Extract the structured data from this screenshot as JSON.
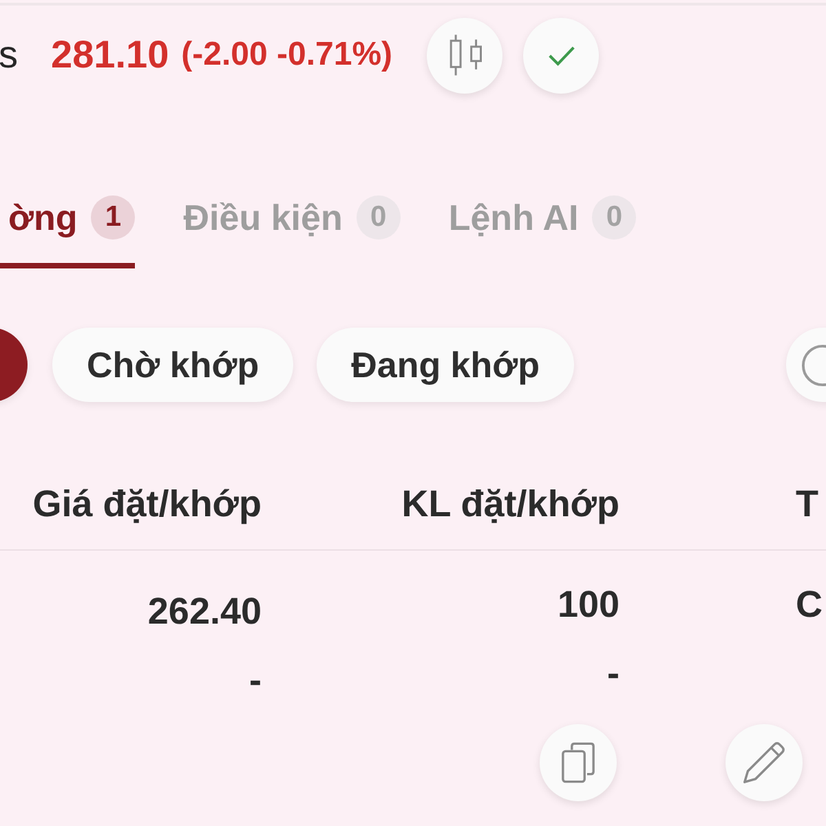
{
  "header": {
    "symbol": "s",
    "price": "281.10",
    "change": "(-2.00 -0.71%)",
    "falling": true,
    "tools": [
      {
        "kind": "candles"
      },
      {
        "kind": "confirm"
      }
    ]
  },
  "tabs": [
    {
      "label": "ờng",
      "count": "1",
      "selected": true
    },
    {
      "label": "Điều kiện",
      "count": "0",
      "selected": false
    },
    {
      "label": "Lệnh AI",
      "count": "0",
      "selected": false
    }
  ],
  "filter_chips": [
    {
      "kind": "edge",
      "selected": true
    },
    {
      "kind": "text",
      "label": "Chờ khớp",
      "selected": false
    },
    {
      "kind": "text",
      "label": "Đang khớp",
      "selected": false
    },
    {
      "kind": "icon",
      "selected": false
    }
  ],
  "table": {
    "columns": [
      "Giá đặt/khớp",
      "KL đặt/khớp",
      "T"
    ],
    "rows": [
      {
        "cells": [
          {
            "value": "262.40",
            "sub": "-"
          },
          {
            "value": "100",
            "sub": "-"
          },
          {
            "value": "C"
          }
        ]
      }
    ]
  },
  "row_actions": [
    {
      "kind": "copy"
    },
    {
      "kind": "edit"
    }
  ]
}
